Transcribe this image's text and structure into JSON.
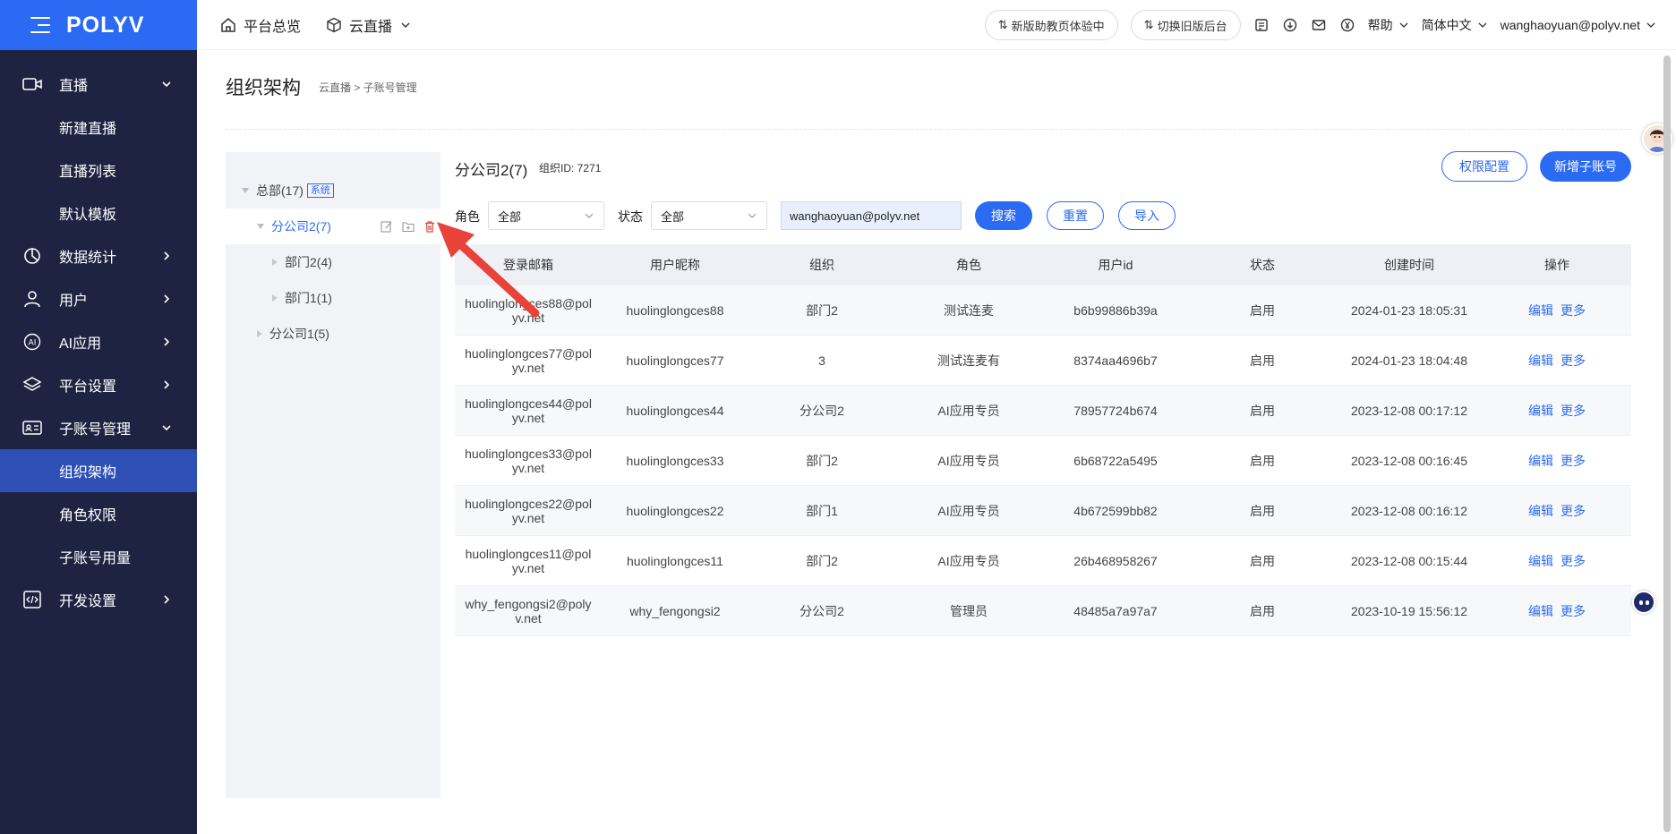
{
  "sidebar": {
    "logo": "POLYV",
    "items": [
      {
        "label": "直播",
        "icon": "video-icon",
        "expanded": true
      },
      {
        "label": "新建直播"
      },
      {
        "label": "直播列表"
      },
      {
        "label": "默认模板"
      },
      {
        "label": "数据统计",
        "icon": "pie-chart-icon"
      },
      {
        "label": "用户",
        "icon": "user-icon"
      },
      {
        "label": "AI应用",
        "icon": "ai-icon"
      },
      {
        "label": "平台设置",
        "icon": "layers-icon"
      },
      {
        "label": "子账号管理",
        "icon": "id-card-icon",
        "expanded": true
      },
      {
        "label": "组织架构",
        "active": true
      },
      {
        "label": "角色权限"
      },
      {
        "label": "子账号用量"
      },
      {
        "label": "开发设置",
        "icon": "code-icon"
      }
    ]
  },
  "header": {
    "home": "平台总览",
    "product": "云直播",
    "new_assist": "新版助教页体验中",
    "switch_old": "切换旧版后台",
    "help": "帮助",
    "language": "简体中文",
    "user": "wanghaoyuan@polyv.net"
  },
  "page": {
    "title": "组织架构",
    "breadcrumb": "云直播 > 子账号管理"
  },
  "tree": {
    "root": {
      "label": "总部(17)",
      "tag": "系统"
    },
    "selected": {
      "label": "分公司2(7)"
    },
    "children": [
      "部门2(4)",
      "部门1(1)"
    ],
    "other": "分公司1(5)"
  },
  "main": {
    "org_name": "分公司2(7)",
    "org_id": "组织ID: 7271",
    "perm_config": "权限配置",
    "add_sub": "新增子账号",
    "filter": {
      "role_label": "角色",
      "role_value": "全部",
      "status_label": "状态",
      "status_value": "全部",
      "email_value": "wanghaoyuan@polyv.net",
      "search": "搜索",
      "reset": "重置",
      "import": "导入"
    },
    "columns": [
      "登录邮箱",
      "用户昵称",
      "组织",
      "角色",
      "用户id",
      "状态",
      "创建时间",
      "操作"
    ],
    "rows": [
      {
        "email": "huolinglongces88@polyv.net",
        "nick": "huolinglongces88",
        "org": "部门2",
        "role": "测试连麦",
        "uid": "b6b99886b39a",
        "status": "启用",
        "time": "2024-01-23 18:05:31",
        "edit": "编辑",
        "more": "更多"
      },
      {
        "email": "huolinglongces77@polyv.net",
        "nick": "huolinglongces77",
        "org": "3",
        "role": "测试连麦有",
        "uid": "8374aa4696b7",
        "status": "启用",
        "time": "2024-01-23 18:04:48",
        "edit": "编辑",
        "more": "更多"
      },
      {
        "email": "huolinglongces44@polyv.net",
        "nick": "huolinglongces44",
        "org": "分公司2",
        "role": "AI应用专员",
        "uid": "78957724b674",
        "status": "启用",
        "time": "2023-12-08 00:17:12",
        "edit": "编辑",
        "more": "更多"
      },
      {
        "email": "huolinglongces33@polyv.net",
        "nick": "huolinglongces33",
        "org": "部门2",
        "role": "AI应用专员",
        "uid": "6b68722a5495",
        "status": "启用",
        "time": "2023-12-08 00:16:45",
        "edit": "编辑",
        "more": "更多"
      },
      {
        "email": "huolinglongces22@polyv.net",
        "nick": "huolinglongces22",
        "org": "部门1",
        "role": "AI应用专员",
        "uid": "4b672599bb82",
        "status": "启用",
        "time": "2023-12-08 00:16:12",
        "edit": "编辑",
        "more": "更多"
      },
      {
        "email": "huolinglongces11@polyv.net",
        "nick": "huolinglongces11",
        "org": "部门2",
        "role": "AI应用专员",
        "uid": "26b468958267",
        "status": "启用",
        "time": "2023-12-08 00:15:44",
        "edit": "编辑",
        "more": "更多"
      },
      {
        "email": "why_fengongsi2@polyv.net",
        "nick": "why_fengongsi2",
        "org": "分公司2",
        "role": "管理员",
        "uid": "48485a7a97a7",
        "status": "启用",
        "time": "2023-10-19 15:56:12",
        "edit": "编辑",
        "more": "更多"
      }
    ]
  },
  "colors": {
    "accent": "#2b6bf3",
    "sidebar": "#1d2341",
    "active": "#2d4fb6",
    "annotation": "#e8423a"
  }
}
